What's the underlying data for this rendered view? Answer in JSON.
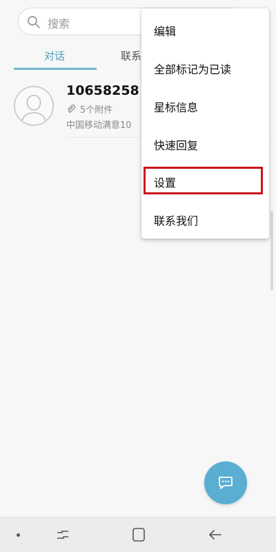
{
  "search": {
    "placeholder": "搜索"
  },
  "tabs": [
    {
      "label": "对话",
      "active": true
    },
    {
      "label": "联系"
    }
  ],
  "conversations": [
    {
      "sender": "10658258",
      "attachments": "5个附件",
      "preview": "中国移动满意10"
    }
  ],
  "menu": {
    "items": [
      {
        "label": "编辑"
      },
      {
        "label": "全部标记为已读"
      },
      {
        "label": "星标信息"
      },
      {
        "label": "快速回复"
      },
      {
        "label": "设置",
        "highlighted": true
      },
      {
        "label": "联系我们"
      }
    ]
  },
  "colors": {
    "accent": "#4a9fbe",
    "fab": "#5aaed2",
    "highlight": "#c9141c"
  },
  "icons": {
    "search": "search-icon",
    "attachment": "paperclip-icon",
    "fab": "compose-message-icon",
    "nav_recents": "recents-icon",
    "nav_home": "home-icon",
    "nav_back": "back-icon"
  }
}
